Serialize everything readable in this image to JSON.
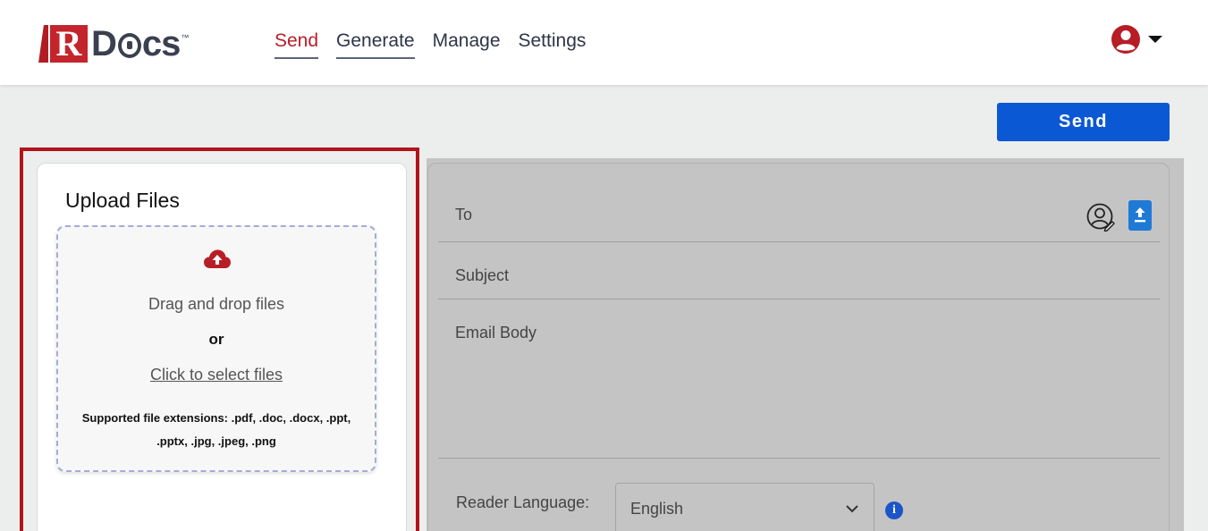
{
  "brand": {
    "logo_letter": "R",
    "logo_text_pre": "D",
    "logo_text_post": "cs",
    "trademark": "™",
    "accent_color": "#b6202a"
  },
  "nav": {
    "items": [
      {
        "label": "Send",
        "active": true
      },
      {
        "label": "Generate",
        "active": false
      },
      {
        "label": "Manage",
        "active": false
      },
      {
        "label": "Settings",
        "active": false
      }
    ]
  },
  "header": {
    "user_icon": "user-circle-icon",
    "menu_icon": "caret-down-icon"
  },
  "toolbar": {
    "send_label": "Send",
    "send_color": "#0b58d5"
  },
  "upload": {
    "title": "Upload Files",
    "icon": "cloud-upload-icon",
    "drag_text": "Drag and drop files",
    "or_text": "or",
    "click_text": "Click to select files",
    "extensions_text": "Supported file extensions: .pdf, .doc, .docx, .ppt, .pptx, .jpg, .jpeg, .png",
    "highlight_color": "#b0131b"
  },
  "email_form": {
    "to_label": "To",
    "subject_label": "Subject",
    "body_label": "Email Body",
    "contact_icon": "contact-edit-icon",
    "upload_contacts_icon": "file-upload-icon",
    "reader_language_label": "Reader Language:",
    "reader_language_value": "English",
    "info_icon": "info-icon"
  }
}
